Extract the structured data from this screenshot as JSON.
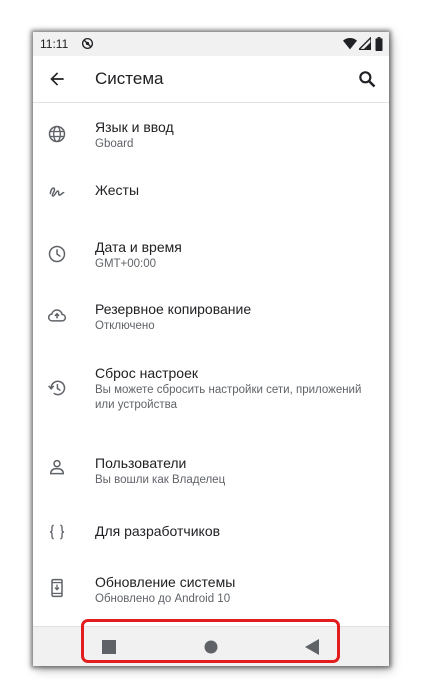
{
  "status_bar": {
    "time": "11:11",
    "icons": [
      "do-not-disturb-icon",
      "wifi-icon",
      "signal-icon",
      "battery-icon"
    ]
  },
  "app_bar": {
    "title": "Система",
    "back_icon": "arrow-back-icon",
    "search_icon": "search-icon"
  },
  "settings": {
    "items": [
      {
        "icon": "globe-icon",
        "title": "Язык и ввод",
        "summary": "Gboard"
      },
      {
        "icon": "gesture-icon",
        "title": "Жесты",
        "summary": ""
      },
      {
        "icon": "clock-icon",
        "title": "Дата и время",
        "summary": "GMT+00:00"
      },
      {
        "icon": "cloud-upload-icon",
        "title": "Резервное копирование",
        "summary": "Отключено"
      },
      {
        "icon": "history-icon",
        "title": "Сброс настроек",
        "summary": "Вы можете сбросить настройки сети, приложений или устройства"
      },
      {
        "icon": "person-icon",
        "title": "Пользователи",
        "summary": "Вы вошли как Владелец"
      },
      {
        "icon": "braces-icon",
        "title": "Для разработчиков",
        "summary": ""
      },
      {
        "icon": "system-update-icon",
        "title": "Обновление системы",
        "summary": "Обновлено до Android 10"
      }
    ]
  },
  "nav_bar": {
    "buttons": [
      "recents-square-icon",
      "home-circle-icon",
      "back-triangle-icon"
    ]
  },
  "colors": {
    "status_bar_bg": "#f1f1f1",
    "nav_bar_bg": "#f1f1f1",
    "highlight": "#e31d1d",
    "icon": "#5f6368",
    "text_primary": "#202124",
    "text_secondary": "#5f6368"
  }
}
